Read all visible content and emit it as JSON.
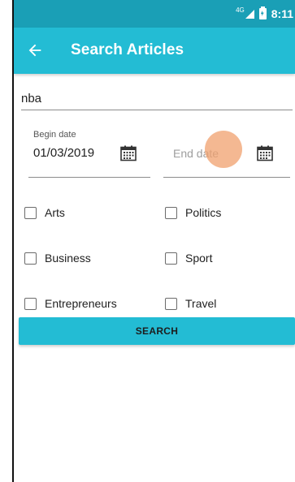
{
  "status_bar": {
    "network": "4G",
    "time": "8:11"
  },
  "app_bar": {
    "title": "Search Articles",
    "back_icon": "arrow-left-icon"
  },
  "search": {
    "query": "nba"
  },
  "dates": {
    "begin_label": "Begin date",
    "begin_value": "01/03/2019",
    "end_placeholder": "End date",
    "calendar_icon": "calendar-icon"
  },
  "categories": [
    {
      "label": "Arts",
      "checked": false
    },
    {
      "label": "Politics",
      "checked": false
    },
    {
      "label": "Business",
      "checked": false
    },
    {
      "label": "Sport",
      "checked": false
    },
    {
      "label": "Entrepreneurs",
      "checked": false
    },
    {
      "label": "Travel",
      "checked": false
    }
  ],
  "actions": {
    "search_label": "SEARCH"
  },
  "colors": {
    "status_bar": "#1a9fb6",
    "accent": "#23bcd4",
    "touch": "#f0a06e"
  }
}
